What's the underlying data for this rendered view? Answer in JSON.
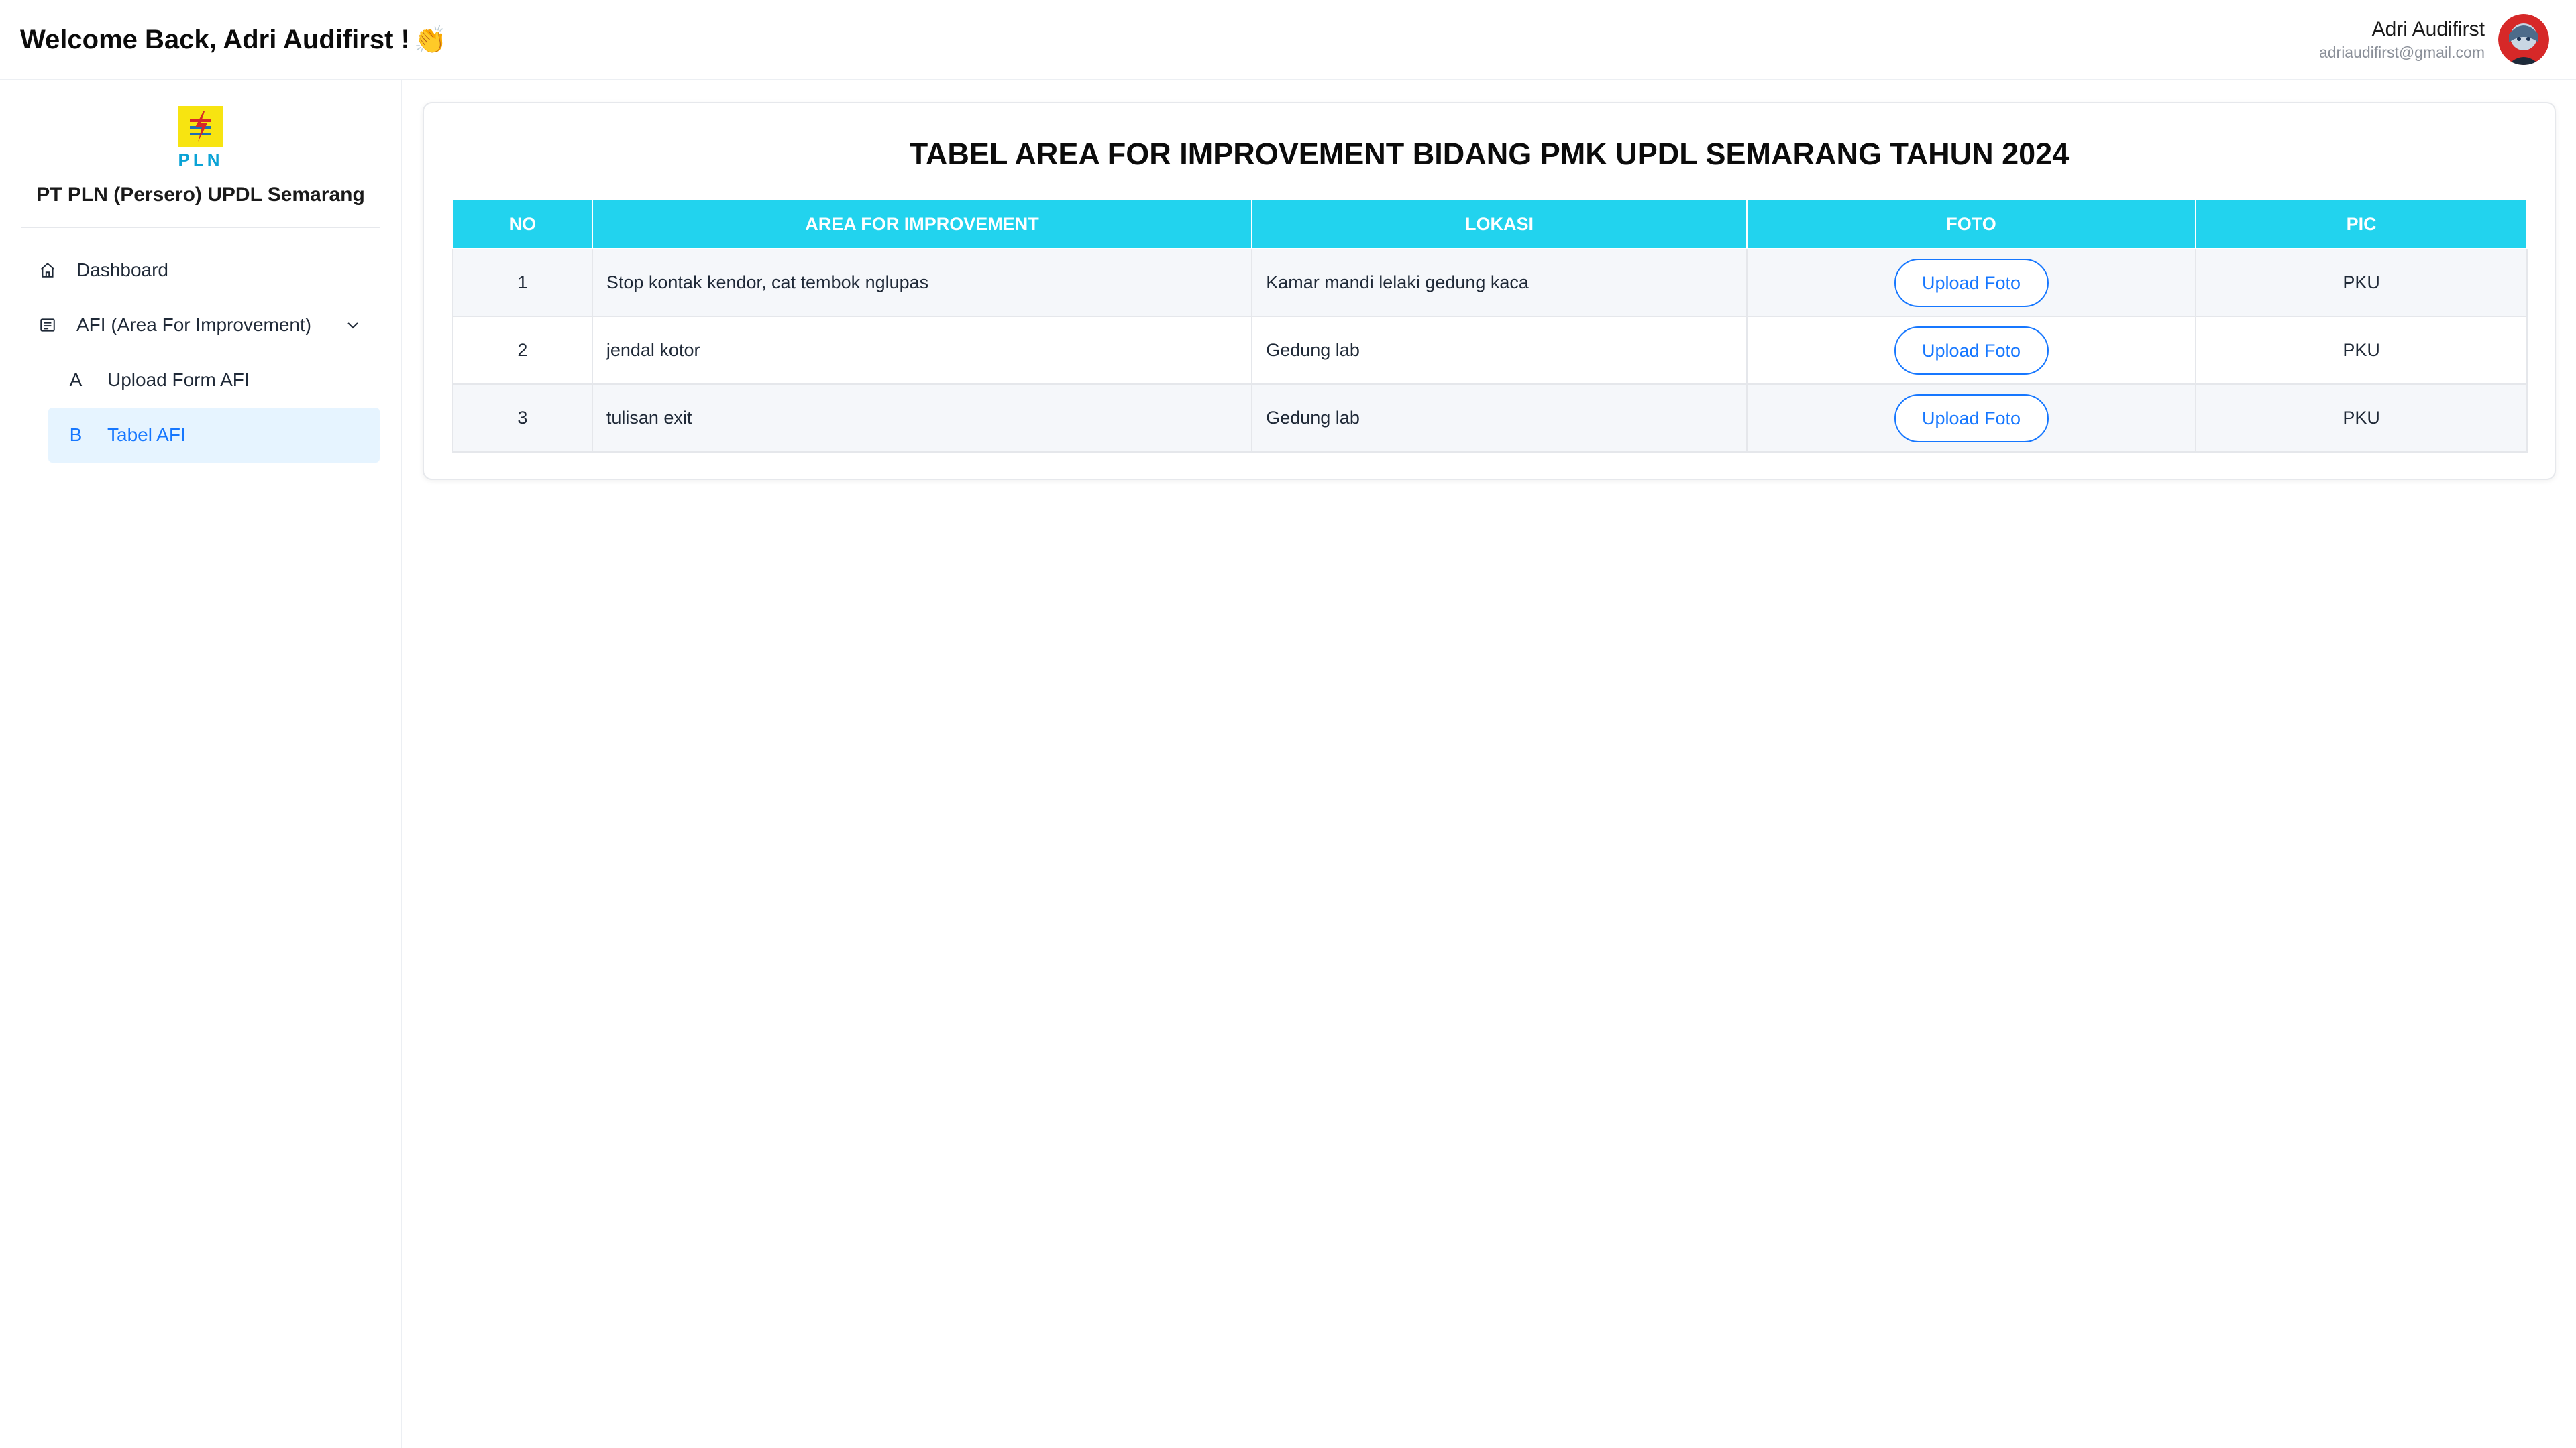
{
  "header": {
    "welcome": "Welcome Back, Adri Audifirst !",
    "wave_emoji": "👏",
    "user_name": "Adri Audifirst",
    "user_email": "adriaudifirst@gmail.com"
  },
  "sidebar": {
    "logo_text": "PLN",
    "company": "PT PLN (Persero) UPDL Semarang",
    "items": [
      {
        "label": "Dashboard",
        "icon": "home-icon"
      },
      {
        "label": "AFI (Area For Improvement)",
        "icon": "document-list-icon",
        "expanded": true
      }
    ],
    "sub_items": [
      {
        "letter": "A",
        "label": "Upload Form AFI",
        "active": false
      },
      {
        "letter": "B",
        "label": "Tabel AFI",
        "active": true
      }
    ]
  },
  "main": {
    "title": "TABEL AREA FOR IMPROVEMENT BIDANG PMK UPDL SEMARANG TAHUN 2024",
    "columns": [
      "NO",
      "AREA FOR IMPROVEMENT",
      "LOKASI",
      "FOTO",
      "PIC"
    ],
    "rows": [
      {
        "no": "1",
        "area": "Stop kontak kendor, cat tembok nglupas",
        "lokasi": "Kamar mandi lelaki gedung kaca",
        "foto": "Upload Foto",
        "pic": "PKU"
      },
      {
        "no": "2",
        "area": "jendal kotor",
        "lokasi": "Gedung lab",
        "foto": "Upload Foto",
        "pic": "PKU"
      },
      {
        "no": "3",
        "area": "tulisan exit",
        "lokasi": "Gedung lab",
        "foto": "Upload Foto",
        "pic": "PKU"
      }
    ]
  },
  "colors": {
    "table_header": "#22d3ee",
    "accent": "#1677ff",
    "active_bg": "#e6f4ff",
    "logo_yellow": "#f7e411",
    "logo_blue": "#0aa3d6"
  }
}
